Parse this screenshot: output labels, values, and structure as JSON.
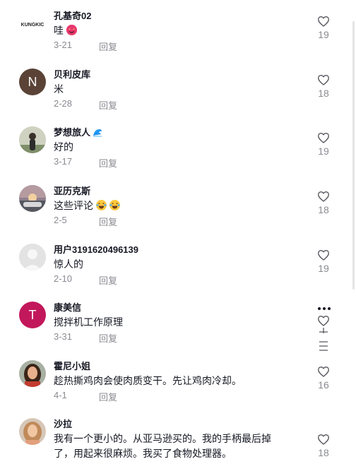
{
  "comments": [
    {
      "username": "孔基奇02",
      "text": "哇",
      "date": "3-21",
      "reply": "回复",
      "likes": "19",
      "avatar_text": "KUNGKIC",
      "avatar_color": "#ffffff"
    },
    {
      "username": "贝利皮库",
      "text": "米",
      "date": "2-28",
      "reply": "回复",
      "likes": "18",
      "avatar_text": "N",
      "avatar_color": "#5a4336"
    },
    {
      "username": "梦想旅人",
      "text": "好的",
      "date": "3-17",
      "reply": "回复",
      "likes": "19",
      "avatar_text": "",
      "avatar_color": "#c9c6a7"
    },
    {
      "username": "亚历克斯",
      "text": "这些评论",
      "date": "2-5",
      "reply": "回复",
      "likes": "18",
      "avatar_text": "",
      "avatar_color": "#7a6d72"
    },
    {
      "username": "用户3191620496139",
      "text": "惊人的",
      "date": "2-10",
      "reply": "回复",
      "likes": "19",
      "avatar_text": "",
      "avatar_color": "#e3e3e4"
    },
    {
      "username": "康美信",
      "text": "搅拌机工作原理",
      "date": "3-31",
      "reply": "回复",
      "likes": "",
      "avatar_text": "T",
      "avatar_color": "#c2185b"
    },
    {
      "username": "霍尼小姐",
      "text": "趁热撕鸡肉会使肉质变干。先让鸡肉冷却。",
      "date": "4-1",
      "reply": "回复",
      "likes": "16",
      "avatar_text": "",
      "avatar_color": "#8d6e63"
    },
    {
      "username": "沙拉",
      "text": "我有一个更小的。从亚马逊买的。我的手柄最后掉",
      "text2": "了，用起来很麻烦。我买了食物处理器。",
      "date": "",
      "reply": "回复",
      "likes": "18",
      "avatar_text": "",
      "avatar_color": "#b98d72"
    }
  ],
  "colors": {
    "muted": "#8a8b91",
    "text": "#161823"
  }
}
